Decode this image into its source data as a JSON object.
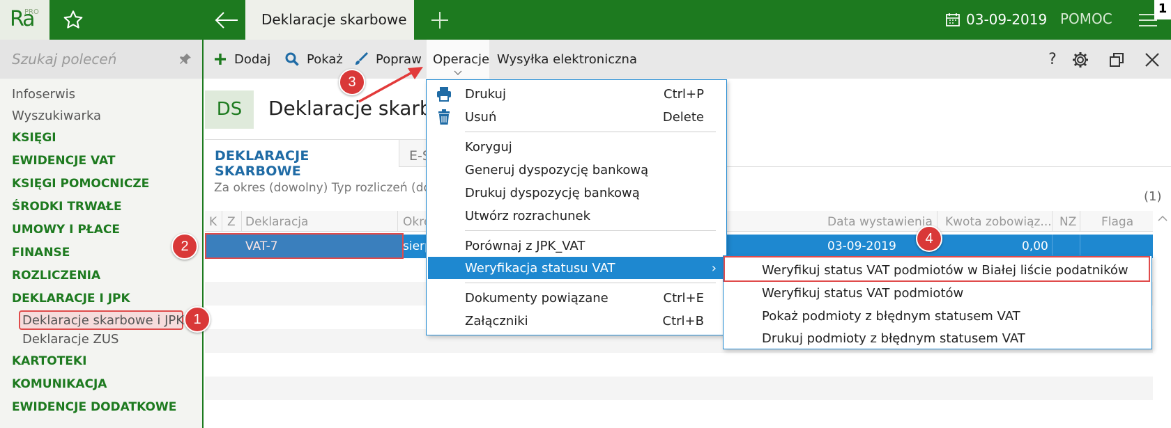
{
  "app": {
    "logo_text": "Ra",
    "logo_badge": "PRO",
    "active_tab": "Deklaracje skarbowe",
    "date": "03-09-2019",
    "help_label": "POMOC",
    "corner_badge": "1"
  },
  "sidebar": {
    "search_placeholder": "Szukaj poleceń",
    "items": [
      {
        "label": "Infoserwis"
      },
      {
        "label": "Wyszukiwarka"
      },
      {
        "label": "KSIĘGI"
      },
      {
        "label": "EWIDENCJE VAT"
      },
      {
        "label": "KSIĘGI POMOCNICZE"
      },
      {
        "label": "ŚRODKI TRWAŁE"
      },
      {
        "label": "UMOWY I PŁACE"
      },
      {
        "label": "FINANSE"
      },
      {
        "label": "ROZLICZENIA"
      },
      {
        "label": "DEKLARACJE I JPK"
      },
      {
        "label": "Deklaracje skarbowe i JPK"
      },
      {
        "label": "Deklaracje ZUS"
      },
      {
        "label": "KARTOTEKI"
      },
      {
        "label": "KOMUNIKACJA"
      },
      {
        "label": "EWIDENCJE DODATKOWE"
      }
    ]
  },
  "toolbar": {
    "add": "Dodaj",
    "show": "Pokaż",
    "edit": "Popraw",
    "operations": "Operacje",
    "eshipping": "Wysyłka elektroniczna",
    "help": "?"
  },
  "header": {
    "badge": "DS",
    "title": "Deklaracje skarbowe"
  },
  "tabs": {
    "tab1": "DEKLARACJE SKARBOWE",
    "tab2": "E-S"
  },
  "filters": {
    "text": "Za okres (dowolny)    Typ rozliczeń (do",
    "count": "(1)"
  },
  "grid": {
    "headers": [
      "K",
      "Z",
      "Deklaracja",
      "Okre",
      "Data wystawienia",
      "Kwota zobowiąz...",
      "NZ",
      "Flaga"
    ],
    "row": {
      "declaration": "VAT-7",
      "period": "sierp",
      "date": "03-09-2019",
      "amount": "0,00"
    }
  },
  "menu": {
    "items": [
      {
        "label": "Drukuj",
        "shortcut": "Ctrl+P"
      },
      {
        "label": "Usuń",
        "shortcut": "Delete"
      },
      {
        "label": "Koryguj",
        "shortcut": ""
      },
      {
        "label": "Generuj dyspozycję bankową",
        "shortcut": ""
      },
      {
        "label": "Drukuj dyspozycję bankową",
        "shortcut": ""
      },
      {
        "label": "Utwórz rozrachunek",
        "shortcut": ""
      },
      {
        "label": "Porównaj z JPK_VAT",
        "shortcut": ""
      },
      {
        "label": "Weryfikacja statusu VAT",
        "shortcut": "›"
      },
      {
        "label": "Dokumenty powiązane",
        "shortcut": "Ctrl+E"
      },
      {
        "label": "Załączniki",
        "shortcut": "Ctrl+B"
      }
    ]
  },
  "submenu": {
    "items": [
      {
        "label": "Weryfikuj status VAT podmiotów w Białej liście podatników"
      },
      {
        "label": "Weryfikuj status VAT podmiotów"
      },
      {
        "label": "Pokaż podmioty z błędnym statusem VAT"
      },
      {
        "label": "Drukuj podmioty z błędnym statusem VAT"
      }
    ]
  },
  "markers": {
    "m1": "1",
    "m2": "2",
    "m3": "3",
    "m4": "4"
  },
  "colors": {
    "brand_green": "#1d7a1f",
    "selection_blue": "#1e88d0",
    "marker_red": "#d93838"
  }
}
